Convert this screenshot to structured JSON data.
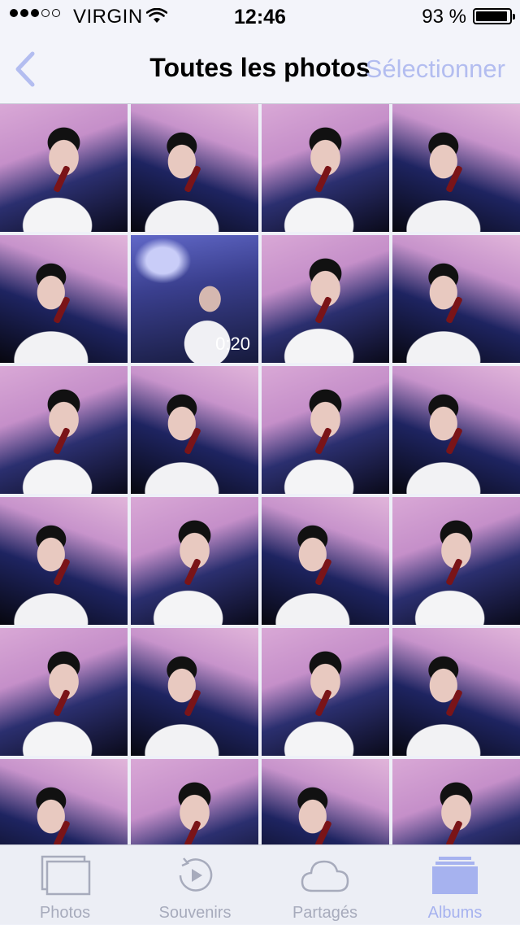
{
  "status_bar": {
    "carrier": "VIRGIN",
    "time": "12:46",
    "battery_percent": "93 %",
    "signal_bars_filled": 3,
    "signal_bars_total": 5
  },
  "nav": {
    "back_icon": "chevron-left-icon",
    "title": "Toutes les photos",
    "select_label": "Sélectionner"
  },
  "grid": {
    "columns": 4,
    "thumbnails": [
      {
        "style": "normal",
        "duration": ""
      },
      {
        "style": "alt",
        "duration": ""
      },
      {
        "style": "normal",
        "duration": ""
      },
      {
        "style": "alt",
        "duration": ""
      },
      {
        "style": "alt",
        "duration": ""
      },
      {
        "style": "video",
        "duration": "0:20"
      },
      {
        "style": "normal",
        "duration": ""
      },
      {
        "style": "alt",
        "duration": ""
      },
      {
        "style": "normal",
        "duration": ""
      },
      {
        "style": "alt",
        "duration": ""
      },
      {
        "style": "normal",
        "duration": ""
      },
      {
        "style": "alt",
        "duration": ""
      },
      {
        "style": "alt",
        "duration": ""
      },
      {
        "style": "normal",
        "duration": ""
      },
      {
        "style": "alt",
        "duration": ""
      },
      {
        "style": "normal",
        "duration": ""
      },
      {
        "style": "normal",
        "duration": ""
      },
      {
        "style": "alt",
        "duration": ""
      },
      {
        "style": "normal",
        "duration": ""
      },
      {
        "style": "alt",
        "duration": ""
      },
      {
        "style": "alt",
        "duration": ""
      },
      {
        "style": "normal",
        "duration": ""
      },
      {
        "style": "alt",
        "duration": ""
      },
      {
        "style": "normal",
        "duration": ""
      }
    ]
  },
  "tab_bar": {
    "tabs": [
      {
        "label": "Photos",
        "icon": "photos-stack-icon",
        "active": false
      },
      {
        "label": "Souvenirs",
        "icon": "memories-play-icon",
        "active": false
      },
      {
        "label": "Partagés",
        "icon": "cloud-icon",
        "active": false
      },
      {
        "label": "Albums",
        "icon": "albums-icon",
        "active": true
      }
    ]
  },
  "colors": {
    "accent_active": "#a6b2ef",
    "tab_inactive": "#a7abbc",
    "select_text": "#b3bdf0"
  }
}
